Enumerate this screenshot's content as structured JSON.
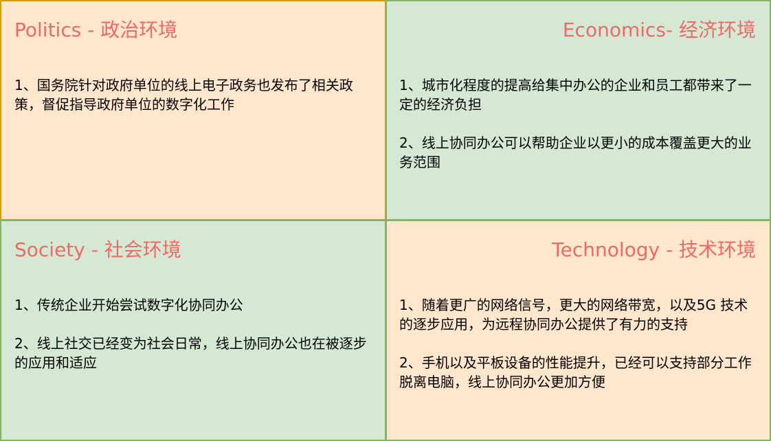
{
  "quadrants": {
    "politics": {
      "title": "Politics - 政治环境",
      "items": [
        "1、国务院针对政府单位的线上电子政务也发布了相关政策，督促指导政府单位的数字化工作"
      ]
    },
    "economics": {
      "title": "Economics- 经济环境",
      "items": [
        "1、城市化程度的提高给集中办公的企业和员工都带来了一定的经济负担",
        "2、线上协同办公可以帮助企业以更小的成本覆盖更大的业务范围"
      ]
    },
    "society": {
      "title": "Society - 社会环境",
      "items": [
        "1、传统企业开始尝试数字化协同办公",
        "2、线上社交已经变为社会日常，线上协同办公也在被逐步的应用和适应"
      ]
    },
    "technology": {
      "title": "Technology - 技术环境",
      "items": [
        "1、随着更广的网络信号，更大的网络带宽，以及5G 技术的逐步应用，为远程协同办公提供了有力的支持",
        "2、手机以及平板设备的性能提升，已经可以支持部分工作脱离电脑，线上协同办公更加方便"
      ]
    }
  },
  "colors": {
    "title_text": "#ea6b66",
    "orange_fill": "#ffe6cc",
    "orange_stroke": "#d79b00",
    "green_fill": "#d5e8d4",
    "green_stroke": "#82b366"
  }
}
